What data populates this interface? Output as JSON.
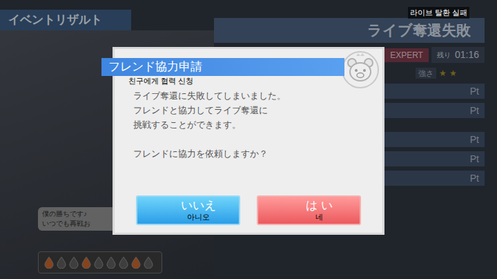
{
  "background": {
    "header": "イベントリザルト",
    "result_title": "ライブ奪還失敗",
    "difficulty": "EXPERT",
    "remaining_label": "残り",
    "remaining": "01:16",
    "strength_label": "強さ",
    "stars": 2,
    "pt_rows": [
      "Pt",
      "Pt",
      "Pt",
      "Pt",
      "Pt"
    ],
    "speech": [
      "僕の勝ちです♪",
      "いつでも再戦お"
    ],
    "drops": [
      true,
      false,
      false,
      true,
      false,
      false,
      false,
      true,
      false
    ]
  },
  "translation_overlay": "라이브 탈환 실패",
  "dialog": {
    "title": "フレンド協力申請",
    "title_translation": "친구에게 협력 신청",
    "message": [
      "ライブ奪還に失敗してしまいました。",
      "フレンドと協力してライブ奪還に",
      "挑戦することができます。",
      "",
      "フレンドに協力を依頼しますか？"
    ],
    "buttons": [
      {
        "label": "いいえ",
        "translation": "아니오",
        "kind": "cancel"
      },
      {
        "label": "は い",
        "translation": "네",
        "kind": "confirm"
      }
    ]
  }
}
